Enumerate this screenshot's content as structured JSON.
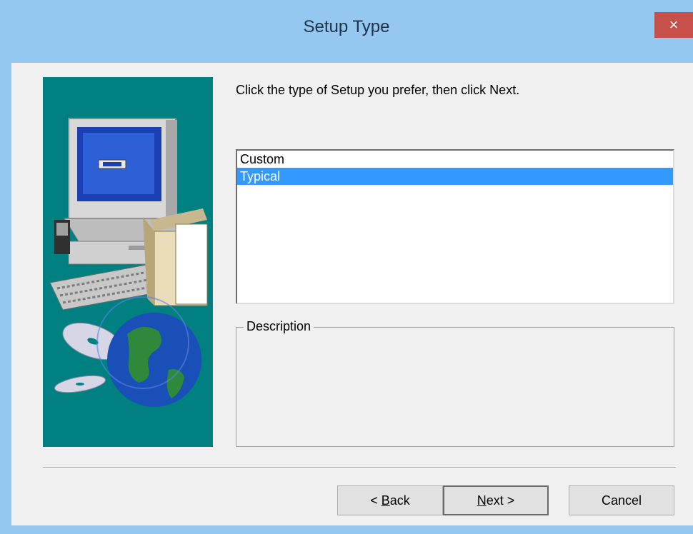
{
  "window": {
    "title": "Setup Type",
    "close_icon": "×"
  },
  "instruction": "Click the type of Setup you prefer, then click Next.",
  "setup_types": {
    "items": [
      {
        "label": "Custom",
        "selected": false
      },
      {
        "label": "Typical",
        "selected": true
      }
    ]
  },
  "description": {
    "legend": "Description",
    "text": ""
  },
  "buttons": {
    "back_prefix": "< ",
    "back_mnemonic": "B",
    "back_rest": "ack",
    "next_mnemonic": "N",
    "next_rest": "ext >",
    "cancel": "Cancel"
  },
  "colors": {
    "titlebar": "#94c8f0",
    "close": "#c7504a",
    "art_background": "#008080",
    "selection": "#3399ff"
  },
  "icons": {
    "art": "computer-with-cds-and-globe"
  }
}
